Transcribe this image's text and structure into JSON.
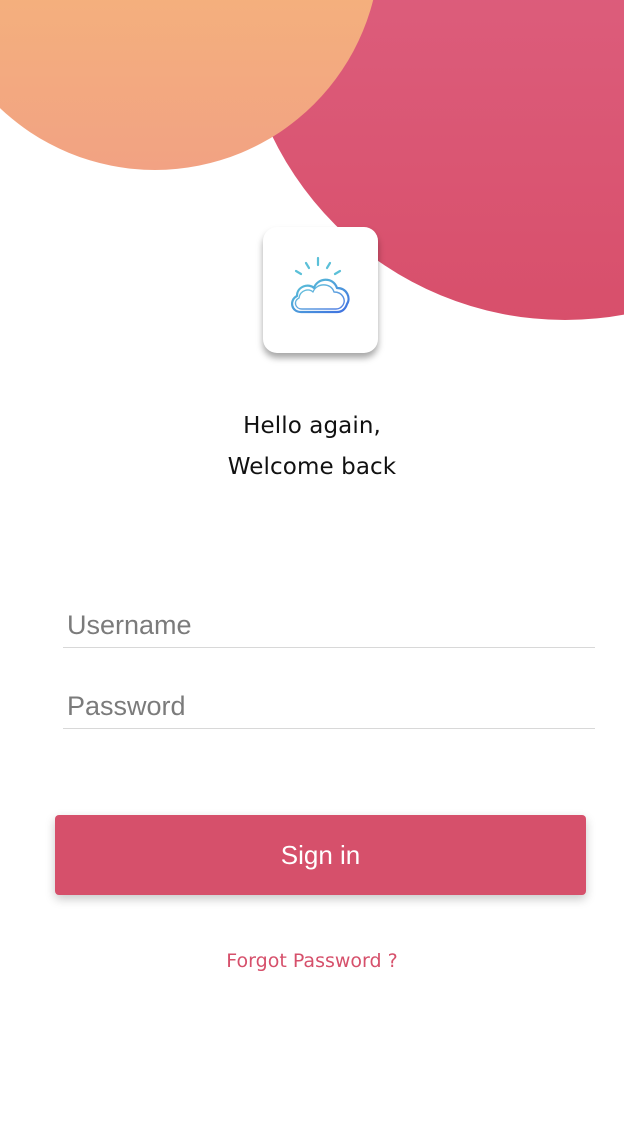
{
  "greeting": {
    "line1": "Hello again,",
    "line2": "Welcome back"
  },
  "login": {
    "username_placeholder": "Username",
    "username_value": "",
    "password_placeholder": "Password",
    "password_value": "",
    "signin_label": "Sign in",
    "forgot_label": "Forgot Password ?"
  },
  "icons": {
    "app": "cloud-sun-icon"
  },
  "colors": {
    "accent": "#d6506b",
    "blob_pink": "#dd5b78",
    "blob_orange": "#f3ad80",
    "icon_stroke": "#4a90e2"
  }
}
